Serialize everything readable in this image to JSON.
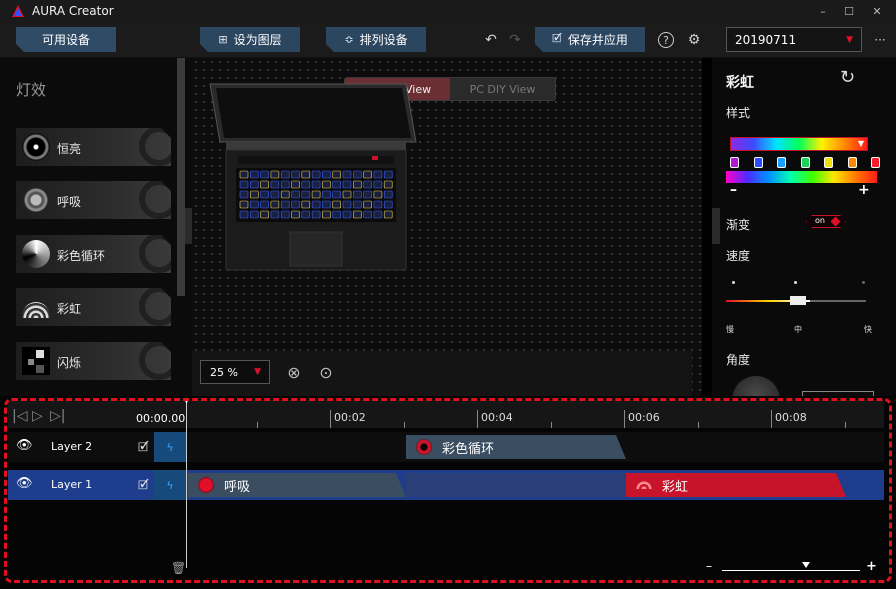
{
  "window": {
    "title": "AURA Creator",
    "controls": {
      "minimize": "–",
      "maximize": "☐",
      "close": "✕"
    }
  },
  "toolbar": {
    "available_devices": "可用设备",
    "set_as_layer": "设为图层",
    "arrange_devices": "排列设备",
    "save_apply": "保存并应用",
    "profile": "20190711",
    "more": "···",
    "help_icon": "?",
    "settings_icon": "⚙"
  },
  "left_panel": {
    "heading": "灯效",
    "effects": [
      {
        "label": "恒亮",
        "icon": "static-icon"
      },
      {
        "label": "呼吸",
        "icon": "breathing-icon"
      },
      {
        "label": "彩色循环",
        "icon": "color-cycle-icon"
      },
      {
        "label": "彩虹",
        "icon": "rainbow-icon"
      },
      {
        "label": "闪烁",
        "icon": "flash-icon"
      }
    ]
  },
  "canvas": {
    "view_tabs": [
      "Device View",
      "PC DIY View"
    ],
    "active_view": "Device View",
    "zoom": "25 %"
  },
  "right_panel": {
    "title": "彩虹",
    "style_label": "样式",
    "gradient_label": "渐变",
    "gradient_toggle": "on",
    "speed_label": "速度",
    "speed_slow": "慢",
    "speed_mid": "中",
    "speed_fast": "快",
    "speed_level": 0.55,
    "angle_label": "角度",
    "minus": "–",
    "plus": "+",
    "color_stops": [
      "#b21bd6",
      "#2a4bff",
      "#1aa0ff",
      "#19d35a",
      "#f2e200",
      "#ff8a00",
      "#ff1b2b"
    ]
  },
  "timeline": {
    "current_time": "00:00.00",
    "ruler": [
      "00:02",
      "00:04",
      "00:06",
      "00:08"
    ],
    "layers": [
      {
        "name": "Layer 2",
        "clips": [
          {
            "label": "彩色循环",
            "type": "gray"
          }
        ]
      },
      {
        "name": "Layer 1",
        "clips": [
          {
            "label": "呼吸",
            "type": "gray"
          },
          {
            "label": "彩虹",
            "type": "red"
          }
        ]
      }
    ],
    "zoom_minus": "–",
    "zoom_plus": "+"
  }
}
